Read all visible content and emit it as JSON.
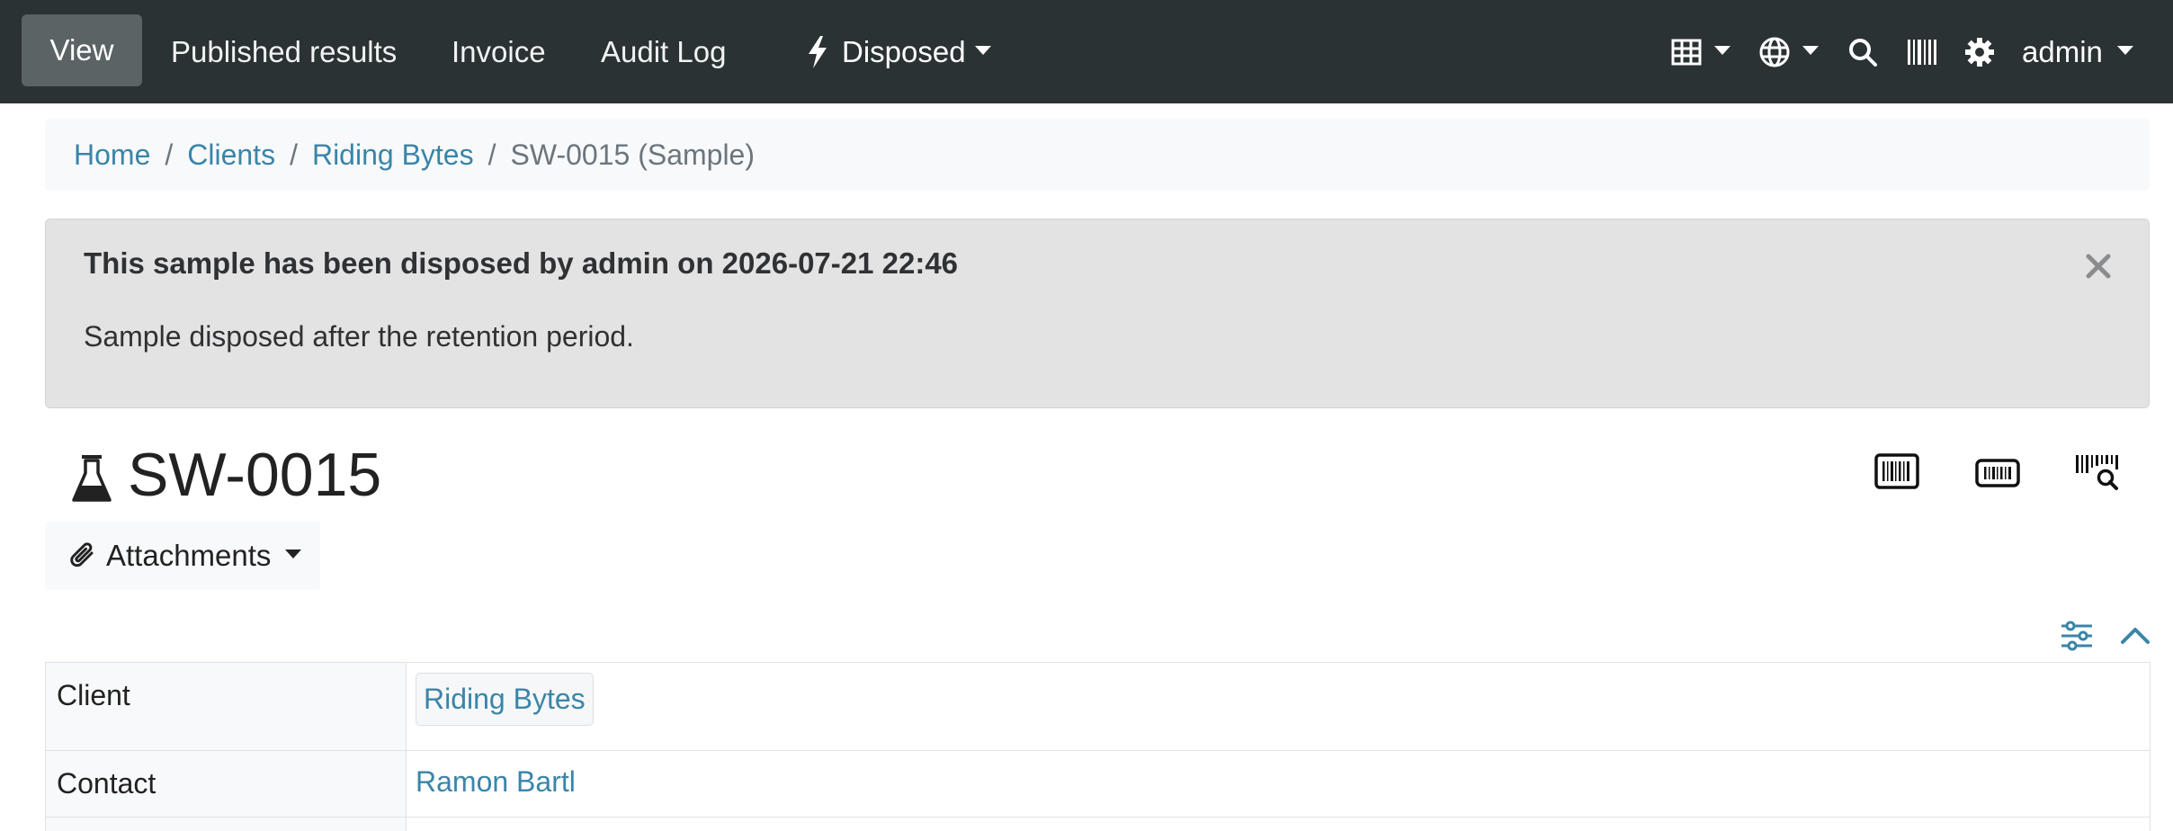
{
  "navbar": {
    "items": [
      {
        "label": "View",
        "active": true
      },
      {
        "label": "Published results"
      },
      {
        "label": "Invoice"
      },
      {
        "label": "Audit Log"
      }
    ],
    "state_label": "Disposed",
    "icons": [
      "bolt-icon",
      "grid-icon",
      "globe-icon",
      "search-icon",
      "barcode-icon",
      "gear-icon"
    ],
    "user": "admin",
    "colors": {
      "background": "#2b3234",
      "active": "#5b6365"
    }
  },
  "breadcrumb": {
    "items": [
      "Home",
      "Clients",
      "Riding Bytes"
    ],
    "current": "SW-0015 (Sample)",
    "separator": "/"
  },
  "alert": {
    "title": "This sample has been disposed by admin on 2026-07-21 22:46",
    "body": "Sample disposed after the retention period.",
    "close": "×"
  },
  "page": {
    "title": "SW-0015",
    "title_icon": "flask-icon",
    "attachments_label": "Attachments"
  },
  "fields": [
    {
      "label": "Client",
      "value": "Riding Bytes"
    },
    {
      "label": "Contact",
      "value": "Ramon Bartl"
    }
  ],
  "colors": {
    "link": "#3a85a8"
  }
}
